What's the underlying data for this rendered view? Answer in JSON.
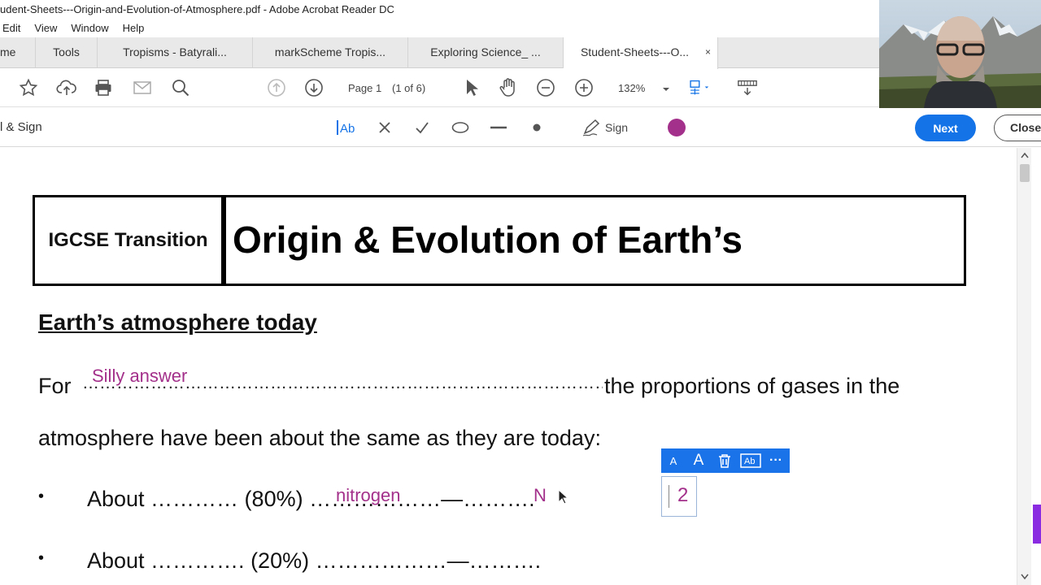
{
  "window": {
    "title": "udent-Sheets---Origin-and-Evolution-of-Atmosphere.pdf - Adobe Acrobat Reader DC"
  },
  "menu": {
    "items": [
      "Edit",
      "View",
      "Window",
      "Help"
    ]
  },
  "tabs": [
    {
      "label": "me"
    },
    {
      "label": "Tools"
    },
    {
      "label": "Tropisms - Batyrali..."
    },
    {
      "label": "markScheme Tropis..."
    },
    {
      "label": "Exploring Science_ ..."
    },
    {
      "label": "Student-Sheets---O..."
    }
  ],
  "tab_close": "×",
  "toolbar": {
    "page_label": "Page 1",
    "page_count": "(1 of 6)",
    "zoom": "132%"
  },
  "fillsign": {
    "label": "l & Sign",
    "text_tool": "Ab",
    "sign_label": "Sign",
    "color": "#a3308a",
    "next_label": "Next",
    "close_label": "Close"
  },
  "document": {
    "header_left": "IGCSE Transition",
    "header_title": "Origin & Evolution of Earth’s",
    "section_heading": "Earth’s atmosphere today",
    "line1_prefix": "For",
    "line1_dots": "……………………………………………………………………………………………………………………………………………,",
    "line1_suffix": "the proportions of gases in the",
    "line2": "atmosphere have been about the same as they are today:",
    "bullet": "•",
    "bullet1": "About ………… (80%) ………………—……….",
    "bullet2": "About …………. (20%) ………………—……….",
    "annotation_silly": "Silly answer",
    "annotation_nitrogen": "nitrogen",
    "annotation_N": "N",
    "textbox_value": "2"
  },
  "mini_toolbar": {
    "small_A": "A",
    "large_A": "A",
    "more": "···"
  }
}
